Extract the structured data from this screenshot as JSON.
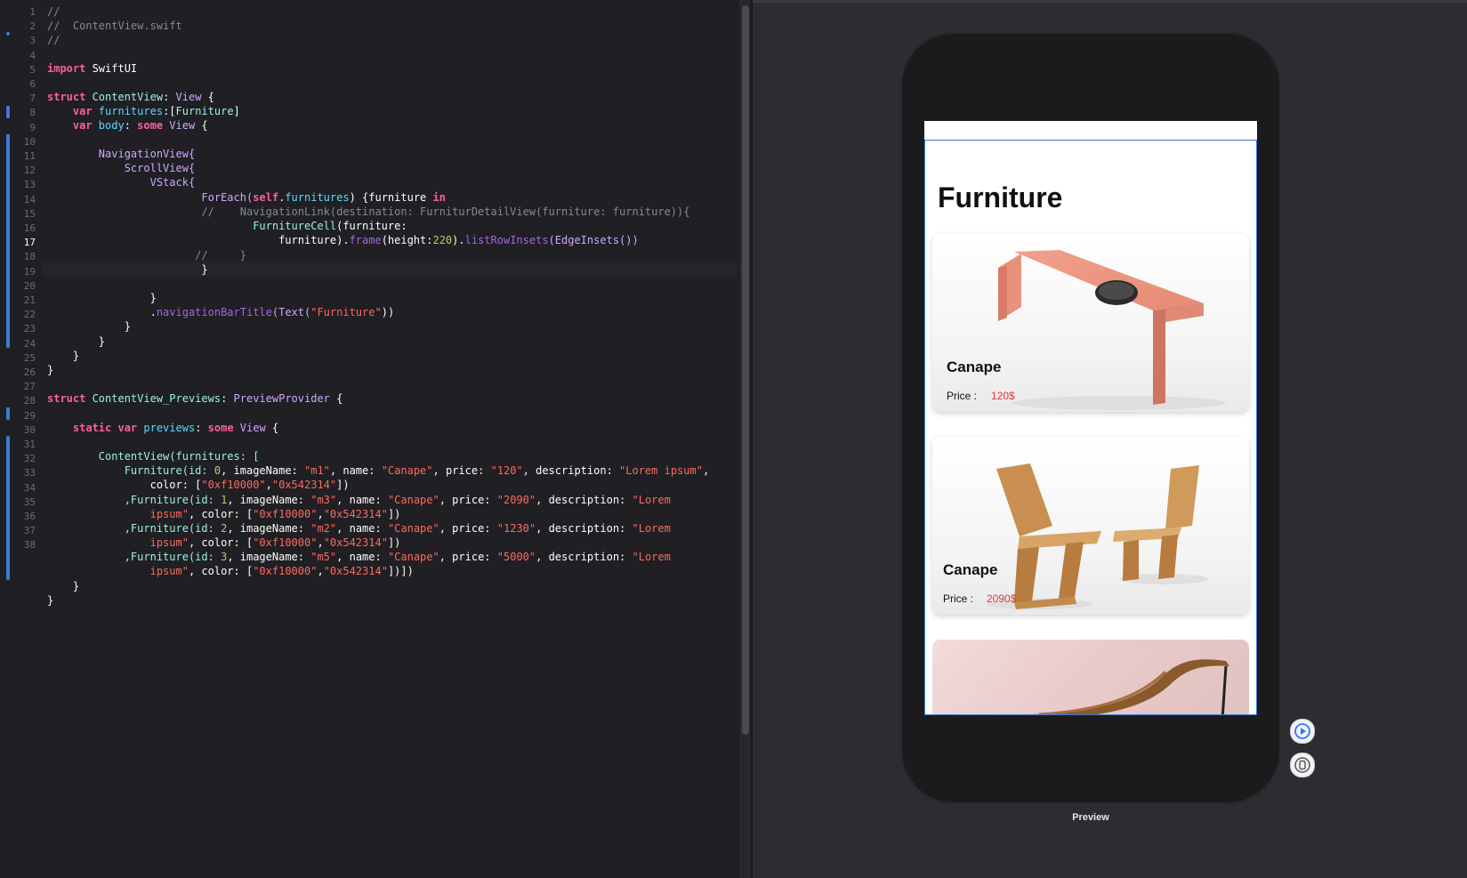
{
  "editor": {
    "active_line": 17,
    "line_numbers": [
      "1",
      "2",
      "3",
      "4",
      "5",
      "6",
      "7",
      "8",
      "9",
      "10",
      "11",
      "12",
      "13",
      "14",
      "15",
      "16",
      "17",
      "18",
      "19",
      "20",
      "21",
      "22",
      "23",
      "24",
      "25",
      "26",
      "27",
      "28",
      "29",
      "30",
      "31",
      "32",
      "33",
      "34",
      "35",
      "36",
      "37",
      "38"
    ],
    "code": {
      "l1": "//",
      "l2": "//  ContentView.swift",
      "l3": "//",
      "l5_kw": "import",
      "l5_rest": " SwiftUI",
      "l7_kw": "struct",
      "l7_name": " ContentView",
      "l7_colon": ": ",
      "l7_type": "View",
      "l7_end": " {",
      "l8_kw": "    var",
      "l8_prop": " furnitures",
      "l8_rest": ":[",
      "l8_type": "Furniture",
      "l8_end": "]",
      "l9_kw": "    var",
      "l9_prop": " body",
      "l9_rest": ": ",
      "l9_kw2": "some",
      "l9_type": " View",
      "l9_end": " {",
      "l11": "        NavigationView{",
      "l12": "            ScrollView{",
      "l13": "                VStack{",
      "l14_a": "                        ForEach(",
      "l14_self": "self",
      "l14_dot": ".",
      "l14_prop": "furnitures",
      "l14_b": ") {furniture ",
      "l14_in": "in",
      "l15": "                        //    NavigationLink(destination: FurniturDetailView(furniture: furniture)){",
      "l16_a": "                                ",
      "l16_cls": "FurnitureCell",
      "l16_b": "(furniture:",
      "l16c_a": "                                    furniture).",
      "l16c_frame": "frame",
      "l16c_b": "(height:",
      "l16c_num": "220",
      "l16c_c": ").",
      "l16c_fn": "listRowInsets",
      "l16c_d": "(EdgeInsets())",
      "l17": "                       //     }",
      "l18": "                        }",
      "l20": "                }",
      "l21_a": "                .",
      "l21_fn": "navigationBarTitle",
      "l21_b": "(Text(",
      "l21_str": "\"Furniture\"",
      "l21_c": "))",
      "l22": "            }",
      "l23": "        }",
      "l24": "    }",
      "l25": "}",
      "l27_kw": "struct",
      "l27_name": " ContentView_Previews",
      "l27_colon": ": ",
      "l27_type": "PreviewProvider",
      "l27_end": " {",
      "l29_kw": "    static var",
      "l29_prop": " previews",
      "l29_rest": ": ",
      "l29_kw2": "some",
      "l29_type": " View",
      "l29_end": " {",
      "l31": "        ContentView(furnitures: [",
      "l32_a": "            Furniture(id: ",
      "l32_id": "0",
      "l32_b": ", imageName: ",
      "l32_img": "\"m1\"",
      "l32_c": ", name: ",
      "l32_name": "\"Canape\"",
      "l32_d": ", price: ",
      "l32_price": "\"120\"",
      "l32_e": ", description: ",
      "l32_desc": "\"Lorem ipsum\"",
      "l32_f": ",",
      "l32c_a": "                color: [",
      "l32c_c1": "\"0xf10000\"",
      "l32c_comma": ",",
      "l32c_c2": "\"0x542314\"",
      "l32c_end": "])",
      "l33_a": "            ,Furniture(id: ",
      "l33_id": "1",
      "l33_b": ", imageName: ",
      "l33_img": "\"m3\"",
      "l33_c": ", name: ",
      "l33_name": "\"Canape\"",
      "l33_d": ", price: ",
      "l33_price": "\"2090\"",
      "l33_e": ", description: ",
      "l33_desc": "\"Lorem",
      "l33c_a": "                ",
      "l33c_desc": "ipsum\"",
      "l33c_b": ", color: [",
      "l33c_c1": "\"0xf10000\"",
      "l33c_comma": ",",
      "l33c_c2": "\"0x542314\"",
      "l33c_end": "])",
      "l34_a": "            ,Furniture(id: ",
      "l34_id": "2",
      "l34_b": ", imageName: ",
      "l34_img": "\"m2\"",
      "l34_c": ", name: ",
      "l34_name": "\"Canape\"",
      "l34_d": ", price: ",
      "l34_price": "\"1230\"",
      "l34_e": ", description: ",
      "l34_desc": "\"Lorem",
      "l34c_a": "                ",
      "l34c_desc": "ipsum\"",
      "l34c_b": ", color: [",
      "l34c_c1": "\"0xf10000\"",
      "l34c_comma": ",",
      "l34c_c2": "\"0x542314\"",
      "l34c_end": "])",
      "l35_a": "            ,Furniture(id: ",
      "l35_id": "3",
      "l35_b": ", imageName: ",
      "l35_img": "\"m5\"",
      "l35_c": ", name: ",
      "l35_name": "\"Canape\"",
      "l35_d": ", price: ",
      "l35_price": "\"5000\"",
      "l35_e": ", description: ",
      "l35_desc": "\"Lorem",
      "l35c_a": "                ",
      "l35c_desc": "ipsum\"",
      "l35c_b": ", color: [",
      "l35c_c1": "\"0xf10000\"",
      "l35c_comma": ",",
      "l35c_c2": "\"0x542314\"",
      "l35c_end": "])])",
      "l36": "    }",
      "l37": "}"
    }
  },
  "preview": {
    "nav_title": "Furniture",
    "cards": [
      {
        "name": "Canape",
        "price_label": "Price :",
        "price": "120$",
        "image": "coffee-table"
      },
      {
        "name": "Canape",
        "price_label": "Price :",
        "price": "2090$",
        "image": "wooden-chairs"
      },
      {
        "name": "",
        "price_label": "",
        "price": "",
        "image": "lounge-chair"
      }
    ],
    "label": "Preview",
    "buttons": [
      "live-preview-icon",
      "device-icon"
    ]
  },
  "colors": {
    "editor_bg": "#1f1f24",
    "keyword": "#fc5fa3",
    "type": "#d0a8ff",
    "string": "#fc6a5d",
    "number": "#d0bf69",
    "comment": "#7f8c98",
    "price": "#e0393e",
    "accent": "#3a7bd5"
  }
}
